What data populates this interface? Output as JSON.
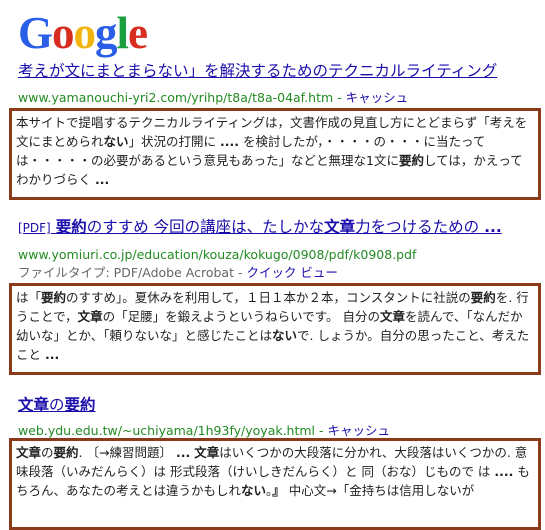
{
  "logo": {
    "letters": [
      "G",
      "o",
      "o",
      "g",
      "l",
      "e"
    ],
    "colors": [
      "#2a5ee8",
      "#d62d20",
      "#f2b50f",
      "#2a5ee8",
      "#1b9e3e",
      "#d62d20"
    ]
  },
  "results": [
    {
      "title": "考えが文にまとまらない」を解決するためのテクニカルライティング",
      "url": "www.yamanouchi-yri2.com/yrihp/t8a/t8a-04af.htm",
      "cache": "キャッシュ",
      "snippet_html": "本サイトで提唱するテクニカルライティングは，文書作成の見直し方にとどまらず「考えを文にまとめられ<b>ない</b>」状況の打開に <b>....</b> を検討したが，・・・・の・・・に当たっては・・・・・の必要があるという意見もあった」などと無理な1文に<b>要約</b>しては，かえってわかりづらく <b>...</b>"
    },
    {
      "pdf_tag": "[PDF]",
      "title_html": "<b>要約</b>のすすめ 今回の講座は、たしかな<b>文章</b>力をつけるための <b>...</b>",
      "url": "www.yomiuri.co.jp/education/kouza/kokugo/0908/pdf/k0908.pdf",
      "filetype_label": "ファイルタイプ: PDF/Adobe Acrobat",
      "quick_view": "クイック ビュー",
      "snippet_html": "は「<b>要約</b>のすすめ」。夏休みを利用して，１日１本か２本，コンスタントに社説の<b>要約</b>を. 行うことで，<b>文章</b>の「足腰」を鍛えようというねらいです。 自分の<b>文章</b>を読んで、「なんだか幼いな」とか、「頼りないな」と感じたことは<b>ない</b>で. しょうか。自分の思ったこと、考えたこと <b>...</b>"
    },
    {
      "title_html": "<b>文章</b>の<b>要約</b>",
      "url": "web.ydu.edu.tw/~uchiyama/1h93fy/yoyak.html",
      "cache": "キャッシュ",
      "snippet_html": "<b>文章</b>の<b>要約</b>. 〔→練習問題〕 <b>...</b> <b>文章</b>はいくつかの大段落に分かれ、大段落はいくつかの. 意味段落（いみだんらく）は 形式段落（けいしきだんらく）と 同（おな）じもので は <b>....</b> もちろん、あなたの考えとは違うかもしれ<b>ない</b>。<b>』</b> 中心文→「金持ちは信用しないが"
    }
  ]
}
